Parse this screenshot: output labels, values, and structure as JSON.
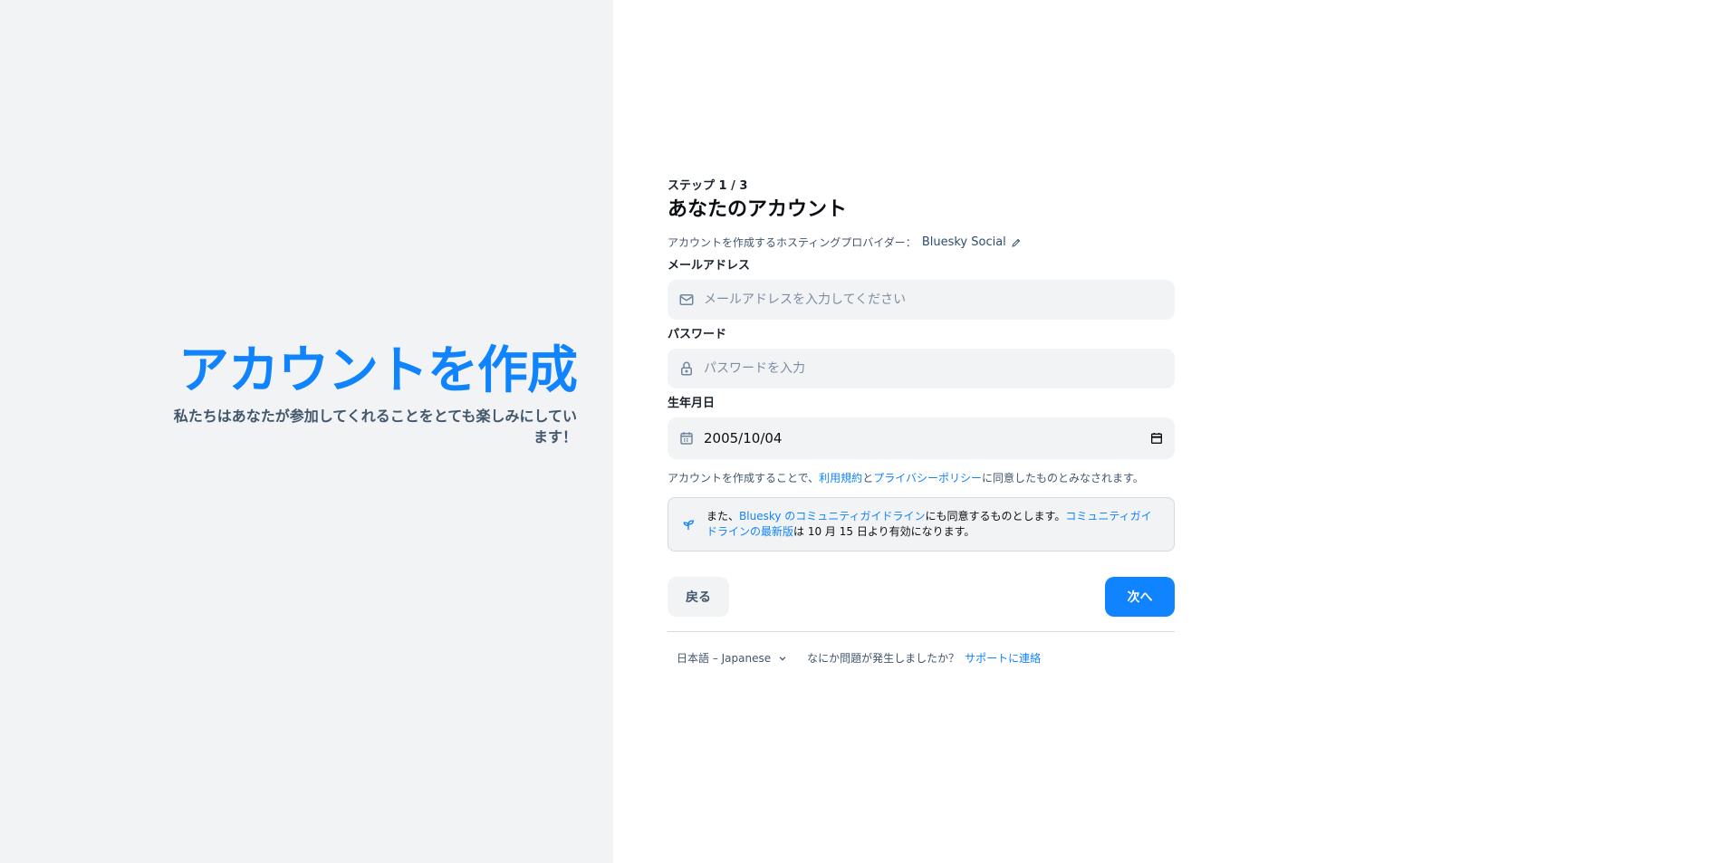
{
  "hero": {
    "title": "アカウントを作成",
    "subtitle": "私たちはあなたが参加してくれることをとても楽しみにしています！"
  },
  "form": {
    "step_label": "ステップ 1 / 3",
    "title": "あなたのアカウント",
    "provider_label": "アカウントを作成するホスティングプロバイダー：",
    "provider_name": "Bluesky Social",
    "email_label": "メールアドレス",
    "email_placeholder": "メールアドレスを入力してください",
    "password_label": "パスワード",
    "password_placeholder": "パスワードを入力",
    "birthdate_label": "生年月日",
    "birthdate_value": "2005/10/04",
    "terms_prefix": "アカウントを作成することで、",
    "terms_link": "利用規約",
    "terms_and": "と",
    "privacy_link": "プライバシーポリシー",
    "terms_suffix": "に同意したものとみなされます。",
    "guideline_prefix": "また、",
    "guideline_link": "Bluesky のコミュニティガイドライン",
    "guideline_middle": "にも同意するものとします。",
    "guideline_update_link": "コミュニティガイドラインの最新版",
    "guideline_suffix": "は 10 月 15 日より有効になります。",
    "back_label": "戻る",
    "next_label": "次へ"
  },
  "footer": {
    "language": "日本語 – Japanese",
    "help_text": "なにか問題が発生しましたか？",
    "support_link": "サポートに連絡"
  },
  "colors": {
    "accent": "#1083fe",
    "left_background": "#f1f3f5"
  }
}
